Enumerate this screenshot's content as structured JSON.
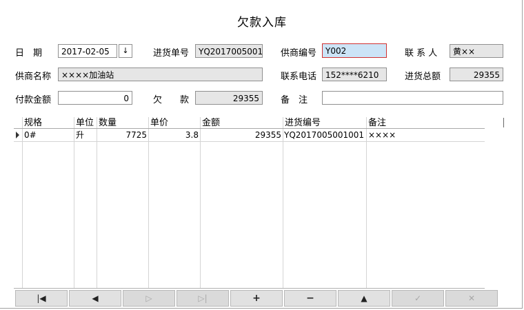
{
  "title": "欠款入库",
  "form": {
    "date_label": "日　期",
    "date_value": "2017-02-05",
    "date_combo": "↓",
    "purchase_no_label": "进货单号",
    "purchase_no_value": "YQ2017005001",
    "supplier_code_label": "供商编号",
    "supplier_code_value": "Y002",
    "contact_label": "联 系 人",
    "contact_value": "黄××",
    "supplier_name_label": "供商名称",
    "supplier_name_value": "××××加油站",
    "phone_label": "联系电话",
    "phone_value": "152****6210",
    "total_label": "进货总额",
    "total_value": "29355",
    "paid_label": "付款金额",
    "paid_value": "0",
    "owed_label": "欠　　款",
    "owed_value": "29355",
    "remark_label": "备　注",
    "remark_value": ""
  },
  "grid": {
    "columns": [
      "规格",
      "单位",
      "数量",
      "单价",
      "金额",
      "进货编号",
      "备注"
    ],
    "rows": [
      {
        "spec": "0#",
        "unit": "升",
        "qty": "7725",
        "price": "3.8",
        "amount": "29355",
        "purchase_no": "YQ2017005001001",
        "remark": "××××"
      }
    ]
  },
  "nav": {
    "first": "|◀",
    "prev": "◀",
    "next": "▷",
    "last": "▷|",
    "add": "+",
    "delete": "−",
    "up": "▲",
    "confirm": "✓",
    "cancel": "✕"
  }
}
